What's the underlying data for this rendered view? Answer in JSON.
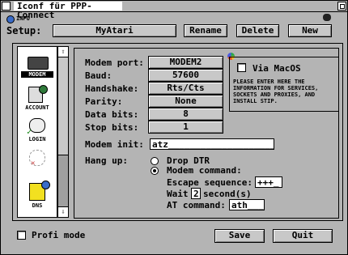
{
  "window": {
    "title": "Iconf für PPP-Connect"
  },
  "info": {
    "label": "INFO"
  },
  "setup": {
    "label": "Setup:",
    "value": "MyAtari",
    "rename": "Rename",
    "delete": "Delete",
    "new": "New"
  },
  "sidebar": {
    "items": [
      {
        "label": "MODEM",
        "selected": true
      },
      {
        "label": "ACCOUNT",
        "selected": false
      },
      {
        "label": "LOGIN",
        "selected": false
      },
      {
        "label": "",
        "selected": false
      },
      {
        "label": "DNS",
        "selected": false
      }
    ]
  },
  "modem": {
    "port_label": "Modem port:",
    "port_value": "MODEM2",
    "baud_label": "Baud:",
    "baud_value": "57600",
    "handshake_label": "Handshake:",
    "handshake_value": "Rts/Cts",
    "parity_label": "Parity:",
    "parity_value": "None",
    "databits_label": "Data bits:",
    "databits_value": "8",
    "stopbits_label": "Stop bits:",
    "stopbits_value": "1",
    "init_label": "Modem init:",
    "init_value": "atz____________________"
  },
  "macos": {
    "checkbox_label": "Via MacOS",
    "note": "PLEASE ENTER HERE THE INFORMATION FOR SERVICES, SOCKETS AND PROXIES, AND INSTALL STIP."
  },
  "hangup": {
    "label": "Hang up:",
    "option_dtr": "Drop DTR",
    "option_command": "Modem command:",
    "escape_label": "Escape sequence:",
    "escape_value": "+++_",
    "wait_prefix": "Wait",
    "wait_value": "2",
    "wait_suffix": "second(s)",
    "at_label": "AT command:",
    "at_value": "ath___",
    "selected": "command"
  },
  "footer": {
    "profi_label": "Profi mode",
    "save": "Save",
    "quit": "Quit"
  }
}
